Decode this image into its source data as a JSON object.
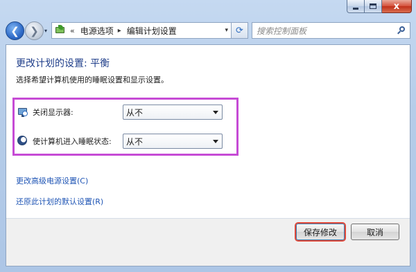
{
  "window": {
    "controls": {
      "minimize_icon": "minimize-icon",
      "maximize_icon": "maximize-icon",
      "close_glyph": "x"
    }
  },
  "nav": {
    "back_glyph": "❮",
    "forward_glyph": "❯",
    "history_dropdown_glyph": "▾"
  },
  "address": {
    "chevron": "«",
    "segments": [
      "电源选项",
      "编辑计划设置"
    ],
    "separator": "▸",
    "dropdown_glyph": "▾",
    "refresh_glyph": "⟳"
  },
  "search": {
    "placeholder": "搜索控制面板"
  },
  "page": {
    "title": "更改计划的设置: 平衡",
    "subtitle": "选择希望计算机使用的睡眠设置和显示设置。",
    "settings": [
      {
        "icon": "monitor-clock-icon",
        "label": "关闭显示器:",
        "value": "从不"
      },
      {
        "icon": "moon-sleep-icon",
        "label": "使计算机进入睡眠状态:",
        "value": "从不"
      }
    ],
    "links": [
      "更改高级电源设置(C)",
      "还原此计划的默认设置(R)"
    ]
  },
  "footer": {
    "save_label": "保存修改",
    "cancel_label": "取消"
  },
  "colors": {
    "title_blue": "#1f3e8a",
    "link_blue": "#1f55b5",
    "highlight_magenta": "#c64bd5",
    "highlight_red": "#e0493a"
  }
}
